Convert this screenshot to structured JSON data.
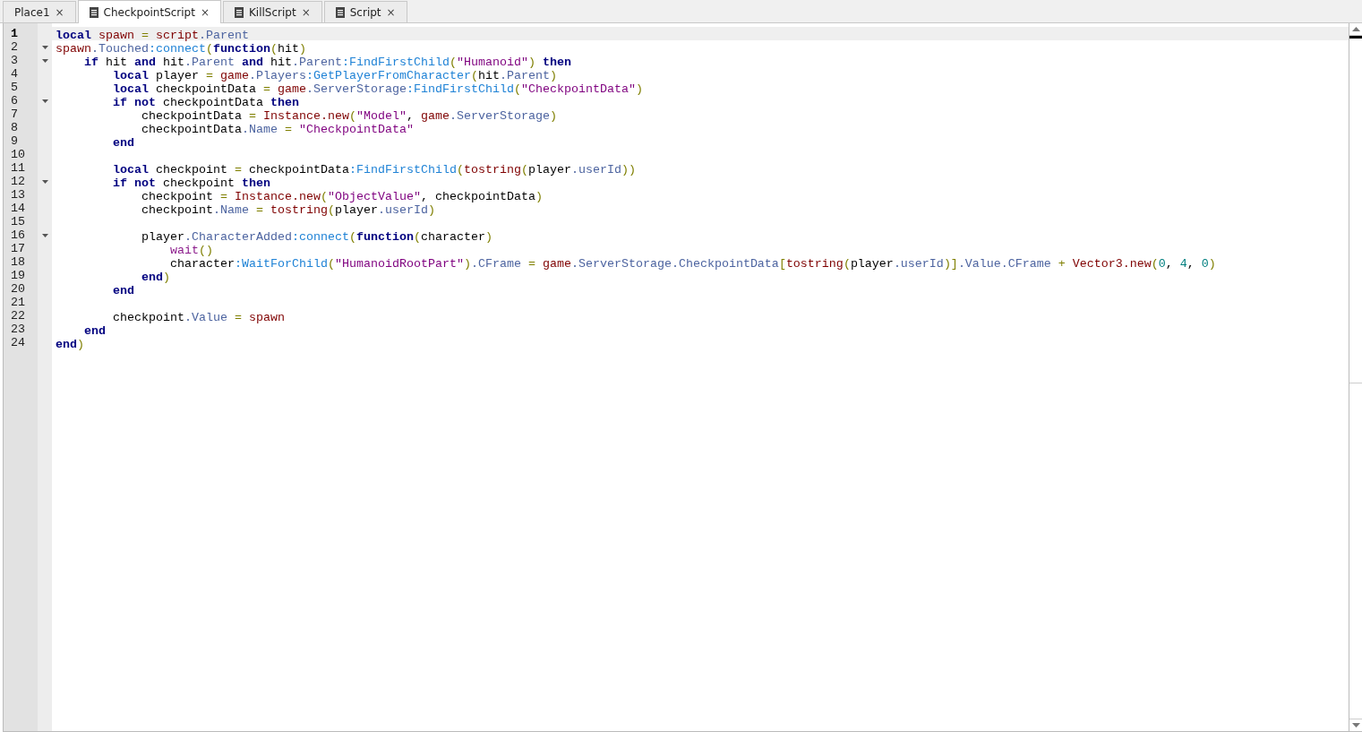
{
  "tabs": [
    {
      "label": "Place1",
      "kind": "place",
      "selected": false,
      "close": "×"
    },
    {
      "label": "CheckpointScript",
      "kind": "script",
      "selected": true,
      "close": "×"
    },
    {
      "label": "KillScript",
      "kind": "script",
      "selected": false,
      "close": "×"
    },
    {
      "label": "Script",
      "kind": "script",
      "selected": false,
      "close": "×"
    }
  ],
  "editor": {
    "lines": [
      {
        "number": "1",
        "current": true,
        "foldable": false,
        "tokens": [
          {
            "kind": "kw",
            "text": "local"
          },
          {
            "kind": "g",
            "text": " spawn"
          },
          {
            "kind": "o",
            "text": " ="
          },
          {
            "kind": "g",
            "text": " script"
          },
          {
            "kind": "pr",
            "text": ".Parent"
          }
        ]
      },
      {
        "number": "2",
        "current": false,
        "foldable": true,
        "tokens": [
          {
            "kind": "g",
            "text": "spawn"
          },
          {
            "kind": "pr",
            "text": ".Touched"
          },
          {
            "kind": "m",
            "text": ":connect"
          },
          {
            "kind": "o",
            "text": "("
          },
          {
            "kind": "kw",
            "text": "function"
          },
          {
            "kind": "o",
            "text": "("
          },
          {
            "kind": "p",
            "text": "hit"
          },
          {
            "kind": "o",
            "text": ")"
          }
        ]
      },
      {
        "number": "3",
        "current": false,
        "foldable": true,
        "tokens": [
          {
            "kind": "kw",
            "text": "    if"
          },
          {
            "kind": "p",
            "text": " hit "
          },
          {
            "kind": "kw",
            "text": "and"
          },
          {
            "kind": "p",
            "text": " hit"
          },
          {
            "kind": "pr",
            "text": ".Parent"
          },
          {
            "kind": "kw",
            "text": " and"
          },
          {
            "kind": "p",
            "text": " hit"
          },
          {
            "kind": "pr",
            "text": ".Parent"
          },
          {
            "kind": "m",
            "text": ":FindFirstChild"
          },
          {
            "kind": "o",
            "text": "("
          },
          {
            "kind": "s",
            "text": "\"Humanoid\""
          },
          {
            "kind": "o",
            "text": ")"
          },
          {
            "kind": "kw",
            "text": " then"
          }
        ]
      },
      {
        "number": "4",
        "current": false,
        "foldable": false,
        "tokens": [
          {
            "kind": "kw",
            "text": "        local"
          },
          {
            "kind": "p",
            "text": " player "
          },
          {
            "kind": "o",
            "text": "="
          },
          {
            "kind": "g",
            "text": " game"
          },
          {
            "kind": "pr",
            "text": ".Players"
          },
          {
            "kind": "m",
            "text": ":GetPlayerFromCharacter"
          },
          {
            "kind": "o",
            "text": "("
          },
          {
            "kind": "p",
            "text": "hit"
          },
          {
            "kind": "pr",
            "text": ".Parent"
          },
          {
            "kind": "o",
            "text": ")"
          }
        ]
      },
      {
        "number": "5",
        "current": false,
        "foldable": false,
        "tokens": [
          {
            "kind": "kw",
            "text": "        local"
          },
          {
            "kind": "p",
            "text": " checkpointData "
          },
          {
            "kind": "o",
            "text": "="
          },
          {
            "kind": "g",
            "text": " game"
          },
          {
            "kind": "pr",
            "text": ".ServerStorage"
          },
          {
            "kind": "m",
            "text": ":FindFirstChild"
          },
          {
            "kind": "o",
            "text": "("
          },
          {
            "kind": "s",
            "text": "\"CheckpointData\""
          },
          {
            "kind": "o",
            "text": ")"
          }
        ]
      },
      {
        "number": "6",
        "current": false,
        "foldable": true,
        "tokens": [
          {
            "kind": "kw",
            "text": "        if"
          },
          {
            "kind": "kw",
            "text": " not"
          },
          {
            "kind": "p",
            "text": " checkpointData "
          },
          {
            "kind": "kw",
            "text": "then"
          }
        ]
      },
      {
        "number": "7",
        "current": false,
        "foldable": false,
        "tokens": [
          {
            "kind": "p",
            "text": "            checkpointData "
          },
          {
            "kind": "o",
            "text": "="
          },
          {
            "kind": "g",
            "text": " Instance.new"
          },
          {
            "kind": "o",
            "text": "("
          },
          {
            "kind": "s",
            "text": "\"Model\""
          },
          {
            "kind": "p",
            "text": ", "
          },
          {
            "kind": "g",
            "text": "game"
          },
          {
            "kind": "pr",
            "text": ".ServerStorage"
          },
          {
            "kind": "o",
            "text": ")"
          }
        ]
      },
      {
        "number": "8",
        "current": false,
        "foldable": false,
        "tokens": [
          {
            "kind": "p",
            "text": "            checkpointData"
          },
          {
            "kind": "pr",
            "text": ".Name"
          },
          {
            "kind": "o",
            "text": " ="
          },
          {
            "kind": "s",
            "text": " \"CheckpointData\""
          }
        ]
      },
      {
        "number": "9",
        "current": false,
        "foldable": false,
        "tokens": [
          {
            "kind": "kw",
            "text": "        end"
          }
        ]
      },
      {
        "number": "10",
        "current": false,
        "foldable": false
      },
      {
        "number": "11",
        "current": false,
        "foldable": false,
        "tokens": [
          {
            "kind": "kw",
            "text": "        local"
          },
          {
            "kind": "p",
            "text": " checkpoint "
          },
          {
            "kind": "o",
            "text": "="
          },
          {
            "kind": "p",
            "text": " checkpointData"
          },
          {
            "kind": "m",
            "text": ":FindFirstChild"
          },
          {
            "kind": "o",
            "text": "("
          },
          {
            "kind": "g",
            "text": "tostring"
          },
          {
            "kind": "o",
            "text": "("
          },
          {
            "kind": "p",
            "text": "player"
          },
          {
            "kind": "pr",
            "text": ".userId"
          },
          {
            "kind": "o",
            "text": "))"
          }
        ]
      },
      {
        "number": "12",
        "current": false,
        "foldable": true,
        "tokens": [
          {
            "kind": "kw",
            "text": "        if"
          },
          {
            "kind": "kw",
            "text": " not"
          },
          {
            "kind": "p",
            "text": " checkpoint "
          },
          {
            "kind": "kw",
            "text": "then"
          }
        ]
      },
      {
        "number": "13",
        "current": false,
        "foldable": false,
        "tokens": [
          {
            "kind": "p",
            "text": "            checkpoint "
          },
          {
            "kind": "o",
            "text": "="
          },
          {
            "kind": "g",
            "text": " Instance.new"
          },
          {
            "kind": "o",
            "text": "("
          },
          {
            "kind": "s",
            "text": "\"ObjectValue\""
          },
          {
            "kind": "p",
            "text": ", checkpointData"
          },
          {
            "kind": "o",
            "text": ")"
          }
        ]
      },
      {
        "number": "14",
        "current": false,
        "foldable": false,
        "tokens": [
          {
            "kind": "p",
            "text": "            checkpoint"
          },
          {
            "kind": "pr",
            "text": ".Name"
          },
          {
            "kind": "o",
            "text": " ="
          },
          {
            "kind": "g",
            "text": " tostring"
          },
          {
            "kind": "o",
            "text": "("
          },
          {
            "kind": "p",
            "text": "player"
          },
          {
            "kind": "pr",
            "text": ".userId"
          },
          {
            "kind": "o",
            "text": ")"
          }
        ]
      },
      {
        "number": "15",
        "current": false,
        "foldable": false
      },
      {
        "number": "16",
        "current": false,
        "foldable": true,
        "tokens": [
          {
            "kind": "p",
            "text": "            player"
          },
          {
            "kind": "pr",
            "text": ".CharacterAdded"
          },
          {
            "kind": "m",
            "text": ":connect"
          },
          {
            "kind": "o",
            "text": "("
          },
          {
            "kind": "kw",
            "text": "function"
          },
          {
            "kind": "o",
            "text": "("
          },
          {
            "kind": "p",
            "text": "character"
          },
          {
            "kind": "o",
            "text": ")"
          }
        ]
      },
      {
        "number": "17",
        "current": false,
        "foldable": false,
        "tokens": [
          {
            "kind": "b",
            "text": "                wait"
          },
          {
            "kind": "o",
            "text": "()"
          }
        ]
      },
      {
        "number": "18",
        "current": false,
        "foldable": false,
        "tokens": [
          {
            "kind": "p",
            "text": "                character"
          },
          {
            "kind": "m",
            "text": ":WaitForChild"
          },
          {
            "kind": "o",
            "text": "("
          },
          {
            "kind": "s",
            "text": "\"HumanoidRootPart\""
          },
          {
            "kind": "o",
            "text": ")"
          },
          {
            "kind": "pr",
            "text": ".CFrame"
          },
          {
            "kind": "o",
            "text": " ="
          },
          {
            "kind": "g",
            "text": " game"
          },
          {
            "kind": "pr",
            "text": ".ServerStorage.CheckpointData"
          },
          {
            "kind": "o",
            "text": "["
          },
          {
            "kind": "g",
            "text": "tostring"
          },
          {
            "kind": "o",
            "text": "("
          },
          {
            "kind": "p",
            "text": "player"
          },
          {
            "kind": "pr",
            "text": ".userId"
          },
          {
            "kind": "o",
            "text": ")]"
          },
          {
            "kind": "pr",
            "text": ".Value.CFrame"
          },
          {
            "kind": "o",
            "text": " +"
          },
          {
            "kind": "g",
            "text": " Vector3.new"
          },
          {
            "kind": "o",
            "text": "("
          },
          {
            "kind": "n",
            "text": "0"
          },
          {
            "kind": "p",
            "text": ", "
          },
          {
            "kind": "n",
            "text": "4"
          },
          {
            "kind": "p",
            "text": ", "
          },
          {
            "kind": "n",
            "text": "0"
          },
          {
            "kind": "o",
            "text": ")"
          }
        ]
      },
      {
        "number": "19",
        "current": false,
        "foldable": false,
        "tokens": [
          {
            "kind": "kw",
            "text": "            end"
          },
          {
            "kind": "o",
            "text": ")"
          }
        ]
      },
      {
        "number": "20",
        "current": false,
        "foldable": false,
        "tokens": [
          {
            "kind": "kw",
            "text": "        end"
          }
        ]
      },
      {
        "number": "21",
        "current": false,
        "foldable": false
      },
      {
        "number": "22",
        "current": false,
        "foldable": false,
        "tokens": [
          {
            "kind": "p",
            "text": "        checkpoint"
          },
          {
            "kind": "pr",
            "text": ".Value"
          },
          {
            "kind": "o",
            "text": " ="
          },
          {
            "kind": "g",
            "text": " spawn"
          }
        ]
      },
      {
        "number": "23",
        "current": false,
        "foldable": false,
        "tokens": [
          {
            "kind": "kw",
            "text": "    end"
          }
        ]
      },
      {
        "number": "24",
        "current": false,
        "foldable": false,
        "tokens": [
          {
            "kind": "kw",
            "text": "end"
          },
          {
            "kind": "o",
            "text": ")"
          }
        ]
      }
    ]
  }
}
